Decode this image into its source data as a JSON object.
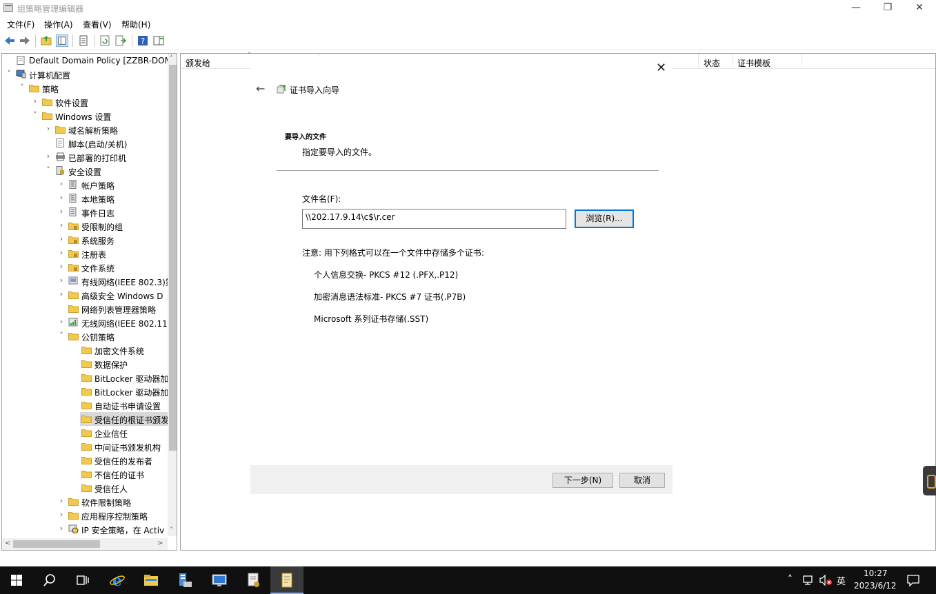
{
  "window": {
    "title": "组策略管理编辑器",
    "minimize_glyph": "—",
    "maximize_glyph": "❐",
    "close_glyph": "✕"
  },
  "menubar": {
    "items": [
      "文件(F)",
      "操作(A)",
      "查看(V)",
      "帮助(H)"
    ]
  },
  "toolbar": {
    "icons": [
      "back-arrow-icon",
      "forward-arrow-icon",
      "up-folder-icon",
      "show-hide-tree-icon",
      "properties-icon",
      "refresh-icon",
      "export-list-icon",
      "help-icon",
      "action-pane-icon"
    ]
  },
  "tree": {
    "items": [
      {
        "label": "Default Domain Policy [ZZBR-DOMAI",
        "level": 0,
        "chevron": "",
        "icon": "policy"
      },
      {
        "label": "计算机配置",
        "level": 0,
        "chevron": "down",
        "icon": "computer"
      },
      {
        "label": "策略",
        "level": 1,
        "chevron": "down",
        "icon": "folder"
      },
      {
        "label": "软件设置",
        "level": 2,
        "chevron": "right",
        "icon": "folder"
      },
      {
        "label": "Windows 设置",
        "level": 2,
        "chevron": "down",
        "icon": "folder"
      },
      {
        "label": "域名解析策略",
        "level": 3,
        "chevron": "right",
        "icon": "folder"
      },
      {
        "label": "脚本(启动/关机)",
        "level": 3,
        "chevron": "",
        "icon": "script"
      },
      {
        "label": "已部署的打印机",
        "level": 3,
        "chevron": "right",
        "icon": "printer"
      },
      {
        "label": "安全设置",
        "level": 3,
        "chevron": "down",
        "icon": "security"
      },
      {
        "label": "帐户策略",
        "level": 4,
        "chevron": "right",
        "icon": "server"
      },
      {
        "label": "本地策略",
        "level": 4,
        "chevron": "right",
        "icon": "server"
      },
      {
        "label": "事件日志",
        "level": 4,
        "chevron": "right",
        "icon": "server"
      },
      {
        "label": "受限制的组",
        "level": 4,
        "chevron": "right",
        "icon": "lockfolder"
      },
      {
        "label": "系统服务",
        "level": 4,
        "chevron": "right",
        "icon": "lockfolder"
      },
      {
        "label": "注册表",
        "level": 4,
        "chevron": "right",
        "icon": "lockfolder"
      },
      {
        "label": "文件系统",
        "level": 4,
        "chevron": "right",
        "icon": "lockfolder"
      },
      {
        "label": "有线网络(IEEE 802.3)策",
        "level": 4,
        "chevron": "right",
        "icon": "network"
      },
      {
        "label": "高级安全 Windows D",
        "level": 4,
        "chevron": "right",
        "icon": "folder"
      },
      {
        "label": "网络列表管理器策略",
        "level": 4,
        "chevron": "",
        "icon": "folder"
      },
      {
        "label": "无线网络(IEEE 802.11",
        "level": 4,
        "chevron": "right",
        "icon": "wireless"
      },
      {
        "label": "公钥策略",
        "level": 4,
        "chevron": "down",
        "icon": "folder"
      },
      {
        "label": "加密文件系统",
        "level": 5,
        "chevron": "",
        "icon": "folder"
      },
      {
        "label": "数据保护",
        "level": 5,
        "chevron": "",
        "icon": "folder"
      },
      {
        "label": "BitLocker 驱动器加",
        "level": 5,
        "chevron": "",
        "icon": "folder"
      },
      {
        "label": "BitLocker 驱动器加",
        "level": 5,
        "chevron": "",
        "icon": "folder"
      },
      {
        "label": "自动证书申请设置",
        "level": 5,
        "chevron": "",
        "icon": "folder"
      },
      {
        "label": "受信任的根证书颁发",
        "level": 5,
        "chevron": "",
        "icon": "folder",
        "selected": true
      },
      {
        "label": "企业信任",
        "level": 5,
        "chevron": "",
        "icon": "folder"
      },
      {
        "label": "中间证书颁发机构",
        "level": 5,
        "chevron": "",
        "icon": "folder"
      },
      {
        "label": "受信任的发布者",
        "level": 5,
        "chevron": "",
        "icon": "folder"
      },
      {
        "label": "不信任的证书",
        "level": 5,
        "chevron": "",
        "icon": "folder"
      },
      {
        "label": "受信任人",
        "level": 5,
        "chevron": "",
        "icon": "folder"
      },
      {
        "label": "软件限制策略",
        "level": 4,
        "chevron": "right",
        "icon": "folder"
      },
      {
        "label": "应用程序控制策略",
        "level": 4,
        "chevron": "right",
        "icon": "folder"
      },
      {
        "label": "IP 安全策略，在 Activ",
        "level": 4,
        "chevron": "right",
        "icon": "ipsec"
      }
    ]
  },
  "columns": {
    "issued_to": "颁发给",
    "status": "状态",
    "template": "证书模板"
  },
  "wizard": {
    "title": "证书导入向导",
    "section_heading": "要导入的文件",
    "section_desc": "指定要导入的文件。",
    "filename_label": "文件名(F):",
    "filename_value": "\\\\202.17.9.14\\c$\\r.cer",
    "browse_label": "浏览(R)...",
    "note": "注意: 用下列格式可以在一个文件中存储多个证书:",
    "formats": [
      "个人信息交换- PKCS #12 (.PFX,.P12)",
      "加密消息语法标准- PKCS #7 证书(.P7B)",
      "Microsoft 系列证书存储(.SST)"
    ],
    "next_label": "下一步(N)",
    "cancel_label": "取消"
  },
  "taskbar": {
    "ime": "英",
    "time": "10:27",
    "date": "2023/6/12"
  },
  "colors": {
    "accent": "#0078d7",
    "taskbar": "#101010",
    "folder": "#f2c94c"
  }
}
